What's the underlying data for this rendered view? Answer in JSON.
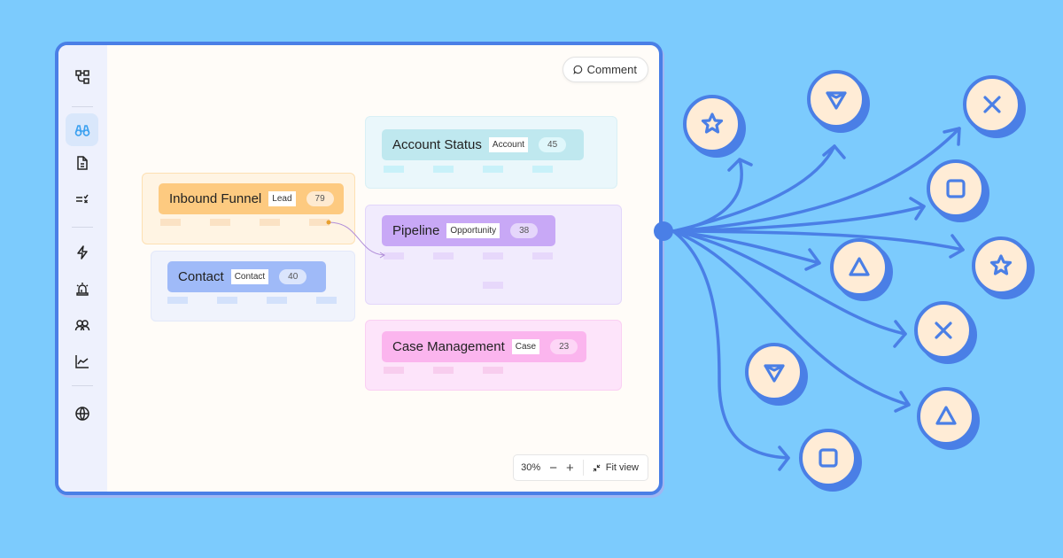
{
  "sidebar": {
    "items": [
      {
        "name": "workflow-icon",
        "active": false
      },
      {
        "name": "binoculars-icon",
        "active": true
      },
      {
        "name": "document-icon",
        "active": false
      },
      {
        "name": "checklist-icon",
        "active": false
      },
      {
        "name": "lightning-icon",
        "active": false
      },
      {
        "name": "siren-icon",
        "active": false
      },
      {
        "name": "users-icon",
        "active": false
      },
      {
        "name": "line-chart-icon",
        "active": false
      },
      {
        "name": "globe-icon",
        "active": false
      }
    ]
  },
  "toolbar": {
    "comment_label": "Comment"
  },
  "nodes": [
    {
      "title": "Account Status",
      "tag": "Account",
      "count": "45",
      "color": "#bfe8ef"
    },
    {
      "title": "Inbound Funnel",
      "tag": "Lead",
      "count": "79",
      "color": "#fdca80"
    },
    {
      "title": "Pipeline",
      "tag": "Opportunity",
      "count": "38",
      "color": "#c8a8f6"
    },
    {
      "title": "Contact",
      "tag": "Contact",
      "count": "40",
      "color": "#9fbaf8"
    },
    {
      "title": "Case Management",
      "tag": "Case",
      "count": "23",
      "color": "#fbb5ee"
    }
  ],
  "zoom": {
    "level": "30%",
    "minus": "−",
    "plus": "+",
    "fit_label": "Fit view"
  },
  "colors": {
    "background": "#7ccbfd",
    "accent": "#4a7fe6",
    "circle_fill": "#ffecd6"
  },
  "decoration": {
    "targets": [
      "star",
      "pointer",
      "x",
      "square",
      "triangle",
      "star",
      "x",
      "pointer",
      "triangle",
      "square"
    ]
  }
}
